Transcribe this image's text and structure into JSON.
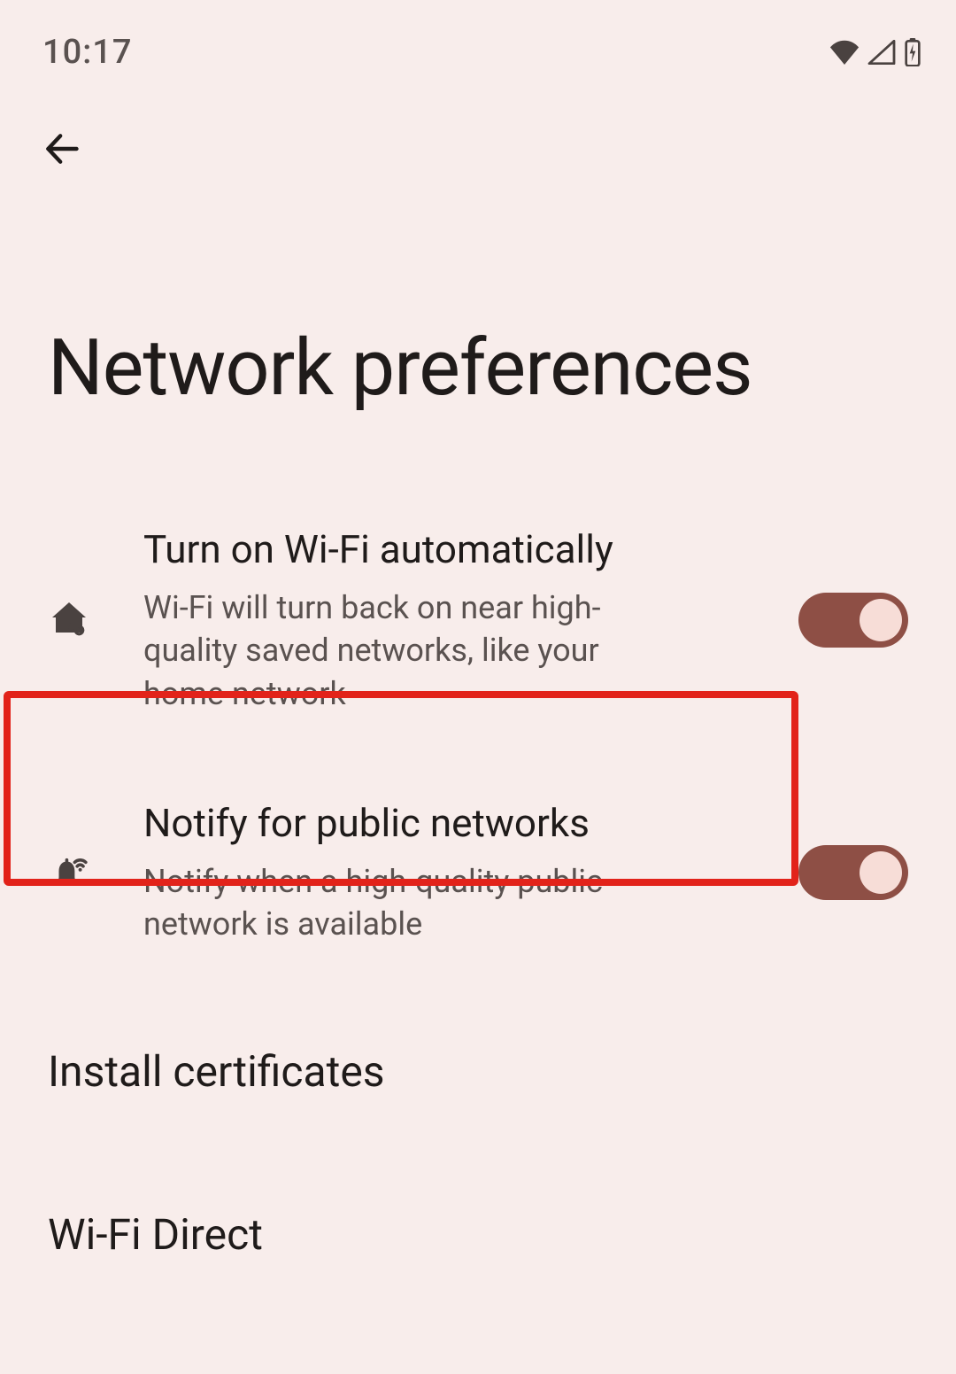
{
  "statusbar": {
    "time": "10:17"
  },
  "header": {
    "title": "Network preferences"
  },
  "settings": {
    "auto_wifi": {
      "title": "Turn on Wi-Fi automatically",
      "subtitle": "Wi-Fi will turn back on near high-quality saved networks, like your home network",
      "enabled": true
    },
    "notify_public": {
      "title": "Notify for public networks",
      "subtitle": "Notify when a high-quality public network is available",
      "enabled": true
    },
    "install_certs": {
      "title": "Install certificates"
    },
    "wifi_direct": {
      "title": "Wi-Fi Direct"
    }
  }
}
